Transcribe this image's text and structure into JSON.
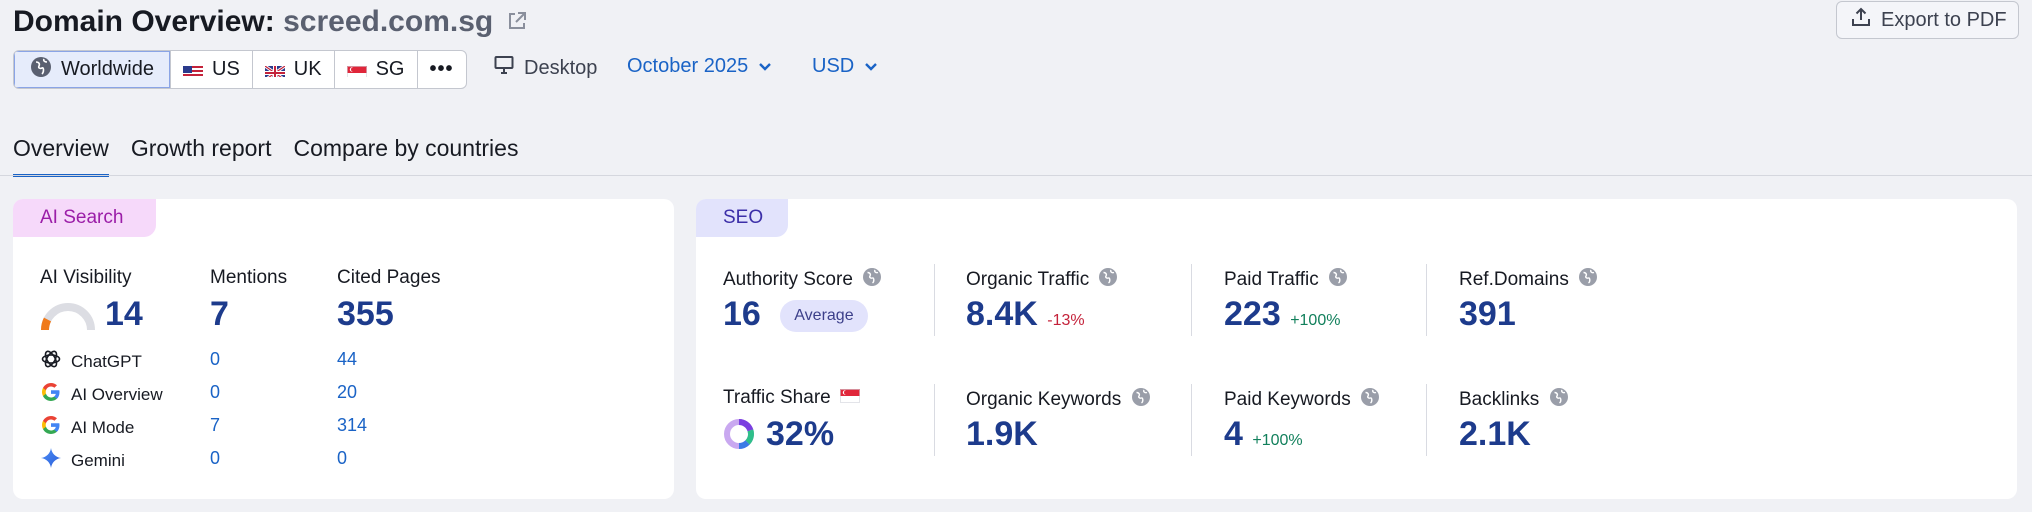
{
  "header": {
    "title_prefix": "Domain Overview:",
    "domain": "screed.com.sg",
    "export_label": "Export to PDF"
  },
  "filters": {
    "countries": [
      {
        "label": "Worldwide",
        "icon": "globe-icon"
      },
      {
        "label": "US",
        "icon": "us-flag-icon"
      },
      {
        "label": "UK",
        "icon": "uk-flag-icon"
      },
      {
        "label": "SG",
        "icon": "sg-flag-icon"
      }
    ],
    "more_label": "•••",
    "device": "Desktop",
    "date": "October 2025",
    "currency": "USD"
  },
  "tabs": [
    {
      "label": "Overview",
      "active": true
    },
    {
      "label": "Growth report",
      "active": false
    },
    {
      "label": "Compare by countries",
      "active": false
    }
  ],
  "ai_search": {
    "tag": "AI Search",
    "visibility_label": "AI Visibility",
    "visibility_value": "14",
    "mentions_label": "Mentions",
    "mentions_value": "7",
    "cited_label": "Cited Pages",
    "cited_value": "355",
    "sources": [
      {
        "name": "ChatGPT",
        "mentions": "0",
        "cited": "44",
        "icon": "chatgpt-icon"
      },
      {
        "name": "AI Overview",
        "mentions": "0",
        "cited": "20",
        "icon": "google-icon"
      },
      {
        "name": "AI Mode",
        "mentions": "7",
        "cited": "314",
        "icon": "google-icon"
      },
      {
        "name": "Gemini",
        "mentions": "0",
        "cited": "0",
        "icon": "gemini-icon"
      }
    ]
  },
  "seo": {
    "tag": "SEO",
    "authority_label": "Authority Score",
    "authority_value": "16",
    "authority_badge": "Average",
    "organic_traffic_label": "Organic Traffic",
    "organic_traffic_value": "8.4K",
    "organic_traffic_delta": "-13%",
    "paid_traffic_label": "Paid Traffic",
    "paid_traffic_value": "223",
    "paid_traffic_delta": "+100%",
    "ref_domains_label": "Ref.Domains",
    "ref_domains_value": "391",
    "traffic_share_label": "Traffic Share",
    "traffic_share_value": "32%",
    "organic_keywords_label": "Organic Keywords",
    "organic_keywords_value": "1.9K",
    "paid_keywords_label": "Paid Keywords",
    "paid_keywords_value": "4",
    "paid_keywords_delta": "+100%",
    "backlinks_label": "Backlinks",
    "backlinks_value": "2.1K"
  },
  "colors": {
    "accent": "#1a63c6",
    "value": "#1d3b8c",
    "negative": "#c4223a",
    "positive": "#12805c"
  }
}
